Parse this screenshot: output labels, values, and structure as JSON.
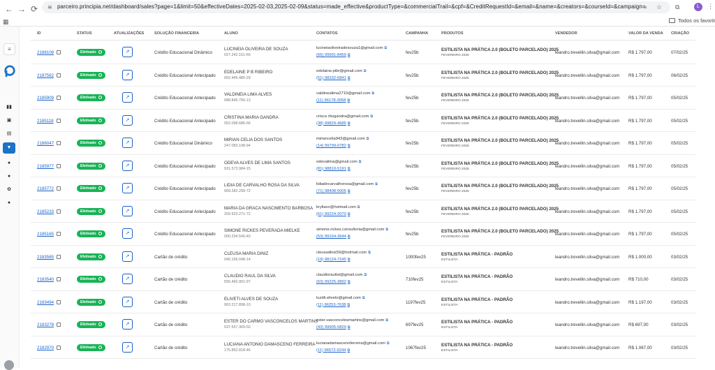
{
  "browser": {
    "url_host": "parceiro.principia.net",
    "url_path": "/dashboard/sales?page=1&limit=50&effectiveDates=2025-02-03,2025-02-09&status=made_effective&productType=&commercialTrail=&cpf=&CreditRequestId=&email=&name=&creators=&courseId=&campaign=",
    "bookmarks_label": "Todos os favoritos",
    "avatar_letter": "L"
  },
  "columns": {
    "id": "ID",
    "status": "STATUS",
    "updates": "ATUALIZAÇÕES",
    "financial": "SOLUÇÃO FINANCEIRA",
    "student": "ALUNO",
    "contacts": "CONTATOS",
    "campaign": "CAMPANHA",
    "products": "PRODUTOS",
    "seller": "VENDEDOR",
    "value": "VALOR DA VENDA",
    "created": "CRIAÇÃO"
  },
  "rows": [
    {
      "id": "2188108",
      "status": "Efetivado",
      "financial": "Crédito Educacional Dinâmico",
      "name": "LUCINEIA OLIVEIRA DE SOUZA",
      "cpf": "027.242.151-65",
      "email": "lucineiaoliveiradesouza1@gmail.com",
      "phone": "(66) 99991-8459",
      "campaign": "fev25b",
      "product": "ESTILISTA NA PRÁTICA 2.0 (BOLETO PARCELADO) 2025",
      "product_sub": "FEVEREIRO 2025",
      "seller": "leandro.trevellin.silva@gmail.com",
      "value": "R$ 1.797,00",
      "created": "07/02/25"
    },
    {
      "id": "2187562",
      "status": "Efetivado",
      "financial": "Crédito Educacional Antecipado",
      "name": "EDELAINE P B RIBEIRO",
      "cpf": "002.445.480-29",
      "email": "edelaine.ptbr@gmail.com",
      "phone": "(51) 98332-6841",
      "campaign": "fev25b",
      "product": "ESTILISTA NA PRÁTICA 2.0 (BOLETO PARCELADO) 2025",
      "product_sub": "FEVEREIRO 2025",
      "seller": "leandro.trevellin.silva@gmail.com",
      "value": "R$ 1.797,00",
      "created": "06/02/25"
    },
    {
      "id": "2185909",
      "status": "Efetivado",
      "financial": "Crédito Educacional Antecipado",
      "name": "VALDINEIA LIMA ALVES",
      "cpf": "088.845.756-13",
      "email": "valdinealima2710@gmail.com",
      "phone": "(11) 96178-3058",
      "campaign": "fev25b",
      "product": "ESTILISTA NA PRÁTICA 2.0 (BOLETO PARCELADO) 2025",
      "product_sub": "FEVEREIRO 2025",
      "seller": "leandro.trevellin.silva@gmail.com",
      "value": "R$ 1.797,00",
      "created": "05/02/25"
    },
    {
      "id": "2185118",
      "status": "Efetivado",
      "financial": "Crédito Educacional Antecipado",
      "name": "CRISTINA MARIA GANDRA",
      "cpf": "052.098.686-56",
      "email": "crisca rbogandra@gmail.com",
      "phone": "(38) 99829-4685",
      "campaign": "fev25b",
      "product": "ESTILISTA NA PRÁTICA 2.0 (BOLETO PARCELADO) 2025",
      "product_sub": "FEVEREIRO 2025",
      "seller": "leandro.trevellin.silva@gmail.com",
      "value": "R$ 1.797,00",
      "created": "05/02/25"
    },
    {
      "id": "2186047",
      "status": "Efetivado",
      "financial": "Crédito Educacional Dinâmico",
      "name": "MIRIAN CELIA DOS SANTOS",
      "cpf": "247.083.198-94",
      "email": "miriancelia943@gmail.com",
      "phone": "(14) 99799-0782",
      "campaign": "fev25b",
      "product": "ESTILISTA NA PRÁTICA 2.0 (BOLETO PARCELADO) 2025",
      "product_sub": "FEVEREIRO 2025",
      "seller": "leandro.trevellin.silva@gmail.com",
      "value": "R$ 1.797,00",
      "created": "05/02/25"
    },
    {
      "id": "2185977",
      "status": "Efetivado",
      "financial": "Crédito Educacional Antecipado",
      "name": "ODEVA ALVES DE LIMA SANTOS",
      "cpf": "931.573.984-15",
      "email": "odevalima@gmail.com",
      "phone": "(81) 98810-5191",
      "campaign": "fev25b",
      "product": "ESTILISTA NA PRÁTICA 2.0 (BOLETO PARCELADO) 2025",
      "product_sub": "FEVEREIRO 2025",
      "seller": "leandro.trevellin.silva@gmail.com",
      "value": "R$ 1.797,00",
      "created": "05/02/25"
    },
    {
      "id": "2185772",
      "status": "Efetivado",
      "financial": "Crédito Educacional Antecipado",
      "name": "LIDIA DE CARVALHO ROSA DA SILVA",
      "cpf": "909.282.299-72",
      "email": "lidiadecarvalhorosa@gmail.com",
      "phone": "(71) 98408-0005",
      "campaign": "fev25b",
      "product": "ESTILISTA NA PRÁTICA 2.0 (BOLETO PARCELADO) 2025",
      "product_sub": "FEVEREIRO 2025",
      "seller": "leandro.trevellin.silva@gmail.com",
      "value": "R$ 1.797,00",
      "created": "05/02/25"
    },
    {
      "id": "2185233",
      "status": "Efetivado",
      "financial": "Crédito Educacional Antecipado",
      "name": "MARIA DA GRACA NASCIMENTO BARBOSA",
      "cpf": "209.923.271-72",
      "email": "kryltavv@hotmail.com",
      "phone": "(61) 99224-2070",
      "campaign": "fev25b",
      "product": "ESTILISTA NA PRÁTICA 2.0 (BOLETO PARCELADO) 2025",
      "product_sub": "FEVEREIRO 2025",
      "seller": "leandro.trevellin.silva@gmail.com",
      "value": "R$ 1.797,00",
      "created": "05/02/25"
    },
    {
      "id": "2185165",
      "status": "Efetivado",
      "financial": "Crédito Educacional Antecipado",
      "name": "SIMONE RICKES PEVERADA MIELKE",
      "cpf": "000.234.540-40",
      "email": "simone.rickes.consultoria@gmail.com",
      "phone": "(53) 99154-3644",
      "campaign": "fev25b",
      "product": "ESTILISTA NA PRÁTICA 2.0 (BOLETO PARCELADO) 2025",
      "product_sub": "FEVEREIRO 2025",
      "seller": "leandro.trevellin.silva@gmail.com",
      "value": "R$ 1.797,00",
      "created": "05/02/25"
    },
    {
      "id": "2183565",
      "status": "Efetivado",
      "financial": "Cartão de crédito",
      "name": "CLEUSA MARIA DINIZ",
      "cpf": "040.156.048-14",
      "email": "cleusadiniz59@hotmail.com",
      "phone": "(19) 98124-7245",
      "campaign": "1000fev25",
      "product": "ESTILISTA NA PRÁTICA - PADRÃO",
      "product_sub": "ESTILISTA",
      "seller": "leandro.trevellin.silva@gmail.com",
      "value": "R$ 1.000,00",
      "created": "03/02/25"
    },
    {
      "id": "2183540",
      "status": "Efetivado",
      "financial": "Cartão de crédito",
      "name": "CLAUDIO RAUL DA SILVA",
      "cpf": "555.460.901-97",
      "email": "claudioraultst@gmail.com",
      "phone": "(63) 99225-3892",
      "campaign": "710fev25",
      "product": "ESTILISTA NA PRÁTICA - PADRÃO",
      "product_sub": "ESTILISTA",
      "seller": "leandro.trevellin.silva@gmail.com",
      "value": "R$ 710,00",
      "created": "03/02/25"
    },
    {
      "id": "2183494",
      "status": "Efetivado",
      "financial": "Cartão de crédito",
      "name": "ELIVETI ALVES DE SOUZA",
      "cpf": "063.217.898-10",
      "email": "luzdli.eliveto@gmail.com",
      "phone": "(11) 96253-7638",
      "campaign": "1197fev25",
      "product": "ESTILISTA NA PRÁTICA - PADRÃO",
      "product_sub": "ESTILISTA",
      "seller": "leandro.trevellin.silva@gmail.com",
      "value": "R$ 1.197,00",
      "created": "03/02/25"
    },
    {
      "id": "2183278",
      "status": "Efetivado",
      "financial": "Cartão de crédito",
      "name": "ESTER DO CARMO VASCONCELOS MARTINS",
      "cpf": "037.557.369-50",
      "email": "ester.vasconcelosmartins@gmail.com",
      "phone": "(43) 99905-0829",
      "campaign": "697fev25",
      "product": "ESTILISTA NA PRÁTICA - PADRÃO",
      "product_sub": "ESTILISTA",
      "seller": "leandro.trevellin.silva@gmail.com",
      "value": "R$ 697,00",
      "created": "03/02/25"
    },
    {
      "id": "2182970",
      "status": "Efetivado",
      "financial": "Cartão de crédito",
      "name": "LUCIANA ANTONIO DAMASCENO FERREIRA",
      "cpf": "175.852.818-46",
      "email": "lucianadamascenoferreira@gmail.com",
      "phone": "(11) 96572-9244",
      "campaign": "1067fev25",
      "product": "ESTILISTA NA PRÁTICA - PADRÃO",
      "product_sub": "ESTILISTA",
      "seller": "leandro.trevellin.silva@gmail.com",
      "value": "R$ 1.067,00",
      "created": "03/02/25"
    }
  ]
}
